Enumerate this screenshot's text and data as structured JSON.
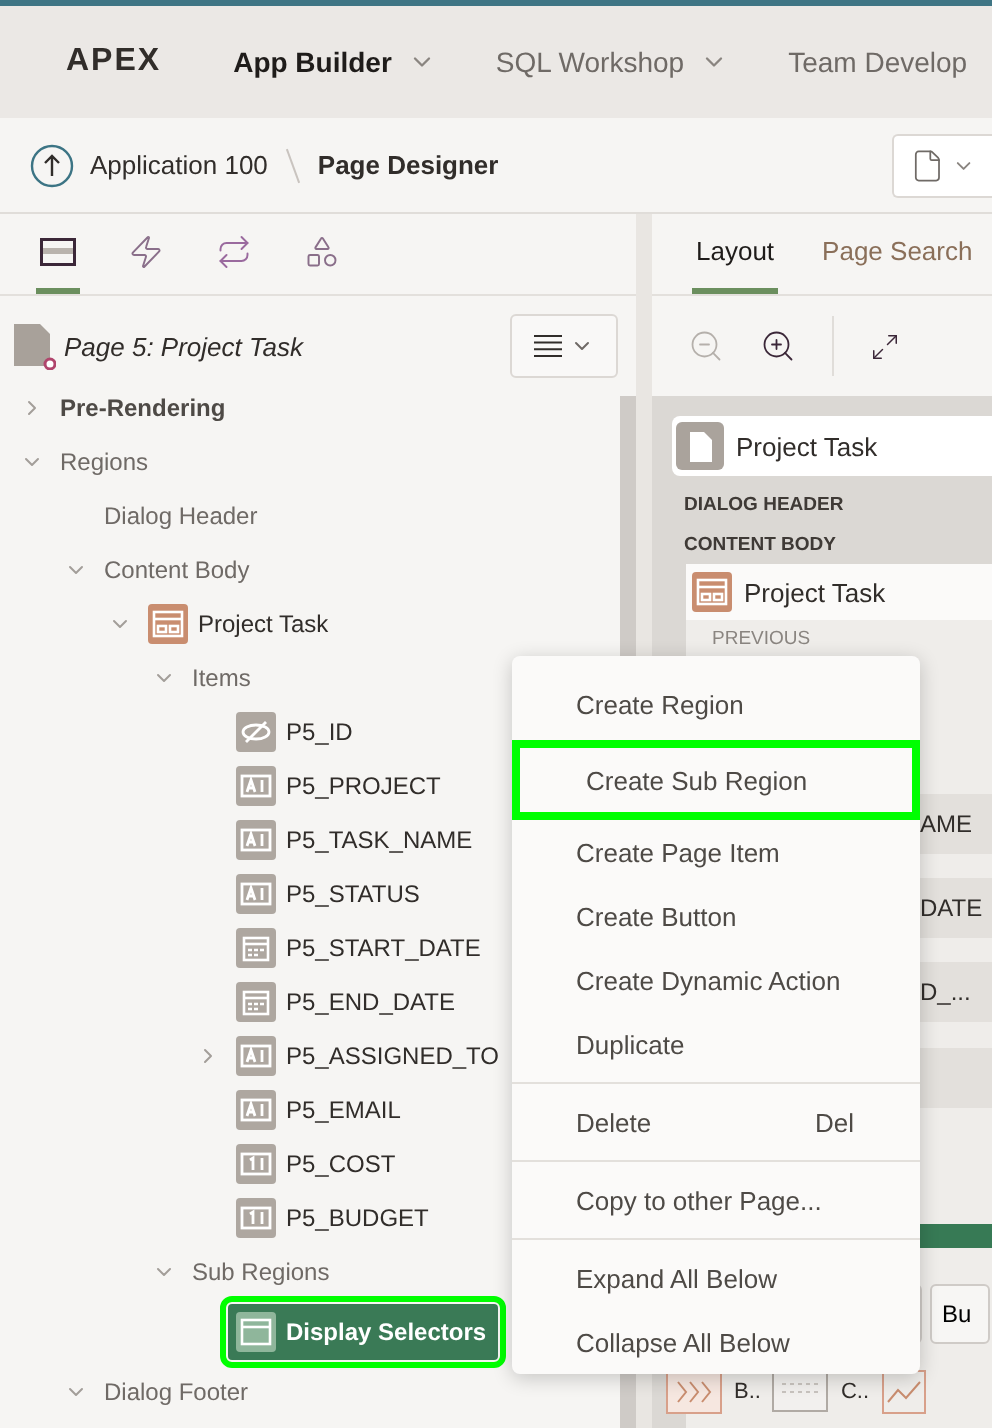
{
  "header": {
    "logo": "APEX",
    "nav": [
      {
        "label": "App Builder",
        "selected": true,
        "has_menu": true
      },
      {
        "label": "SQL Workshop",
        "selected": false,
        "has_menu": true
      },
      {
        "label": "Team Develop",
        "selected": false,
        "has_menu": false
      }
    ]
  },
  "breadcrumb": [
    {
      "label": "Application 100",
      "kind": "link"
    },
    {
      "label": "Page Designer",
      "kind": "current"
    }
  ],
  "left_tabs": [
    {
      "kind": "rendering",
      "selected": true
    },
    {
      "kind": "dynamic_actions",
      "selected": false
    },
    {
      "kind": "processing",
      "selected": false
    },
    {
      "kind": "shared",
      "selected": false
    }
  ],
  "tree": {
    "page_title": "Page 5: Project Task",
    "nodes": [
      {
        "label": "Pre-Rendering",
        "kind": "section",
        "expanded": false,
        "selected": false
      },
      {
        "label": "Regions",
        "kind": "folder",
        "expanded": true,
        "selected": false,
        "children": [
          {
            "label": "Dialog Header",
            "kind": "folder",
            "selected": false
          },
          {
            "label": "Content Body",
            "kind": "folder",
            "expanded": true,
            "selected": false,
            "children": [
              {
                "label": "Project Task",
                "kind": "region",
                "expanded": true,
                "selected": false,
                "children": [
                  {
                    "label": "Items",
                    "kind": "folder",
                    "expanded": true,
                    "selected": false,
                    "children": [
                      {
                        "label": "P5_ID",
                        "kind": "hidden_item",
                        "selected": false
                      },
                      {
                        "label": "P5_PROJECT",
                        "kind": "text_item",
                        "selected": false
                      },
                      {
                        "label": "P5_TASK_NAME",
                        "kind": "text_item",
                        "selected": false
                      },
                      {
                        "label": "P5_STATUS",
                        "kind": "text_item",
                        "selected": false
                      },
                      {
                        "label": "P5_START_DATE",
                        "kind": "date_item",
                        "selected": false
                      },
                      {
                        "label": "P5_END_DATE",
                        "kind": "date_item",
                        "selected": false
                      },
                      {
                        "label": "P5_ASSIGNED_TO",
                        "kind": "text_item",
                        "expanded": false,
                        "selected": false
                      },
                      {
                        "label": "P5_EMAIL",
                        "kind": "text_item",
                        "selected": false
                      },
                      {
                        "label": "P5_COST",
                        "kind": "number_item",
                        "selected": false
                      },
                      {
                        "label": "P5_BUDGET",
                        "kind": "number_item",
                        "selected": false
                      }
                    ]
                  },
                  {
                    "label": "Sub Regions",
                    "kind": "folder",
                    "expanded": true,
                    "selected": false,
                    "children": [
                      {
                        "label": "Display Selectors",
                        "kind": "subregion",
                        "selected": true,
                        "highlighted": true
                      }
                    ]
                  }
                ]
              }
            ]
          },
          {
            "label": "Dialog Footer",
            "kind": "folder",
            "expanded": true,
            "selected": false
          }
        ]
      }
    ]
  },
  "right_tabs": [
    {
      "label": "Layout",
      "selected": true
    },
    {
      "label": "Page Search",
      "selected": false
    }
  ],
  "canvas": {
    "page_card": "Project Task",
    "sections": [
      "DIALOG HEADER",
      "CONTENT BODY"
    ],
    "region_card": "Project Task",
    "region_label": "PREVIOUS",
    "fields": [
      "AME",
      "DATE",
      "D_..."
    ],
    "buttons": [
      "Bu"
    ],
    "gallery": [
      "B..",
      "C.."
    ]
  },
  "context_menu": {
    "groups": [
      [
        {
          "label": "Create Region",
          "highlighted": false
        },
        {
          "label": "Create Sub Region",
          "highlighted": true
        },
        {
          "label": "Create Page Item",
          "highlighted": false
        },
        {
          "label": "Create Button",
          "highlighted": false
        },
        {
          "label": "Create Dynamic Action",
          "highlighted": false
        },
        {
          "label": "Duplicate",
          "highlighted": false
        }
      ],
      [
        {
          "label": "Delete",
          "shortcut": "Del",
          "highlighted": false
        }
      ],
      [
        {
          "label": "Copy to other Page...",
          "highlighted": false
        }
      ],
      [
        {
          "label": "Expand All Below",
          "highlighted": false
        },
        {
          "label": "Collapse All Below",
          "highlighted": false
        }
      ]
    ]
  }
}
